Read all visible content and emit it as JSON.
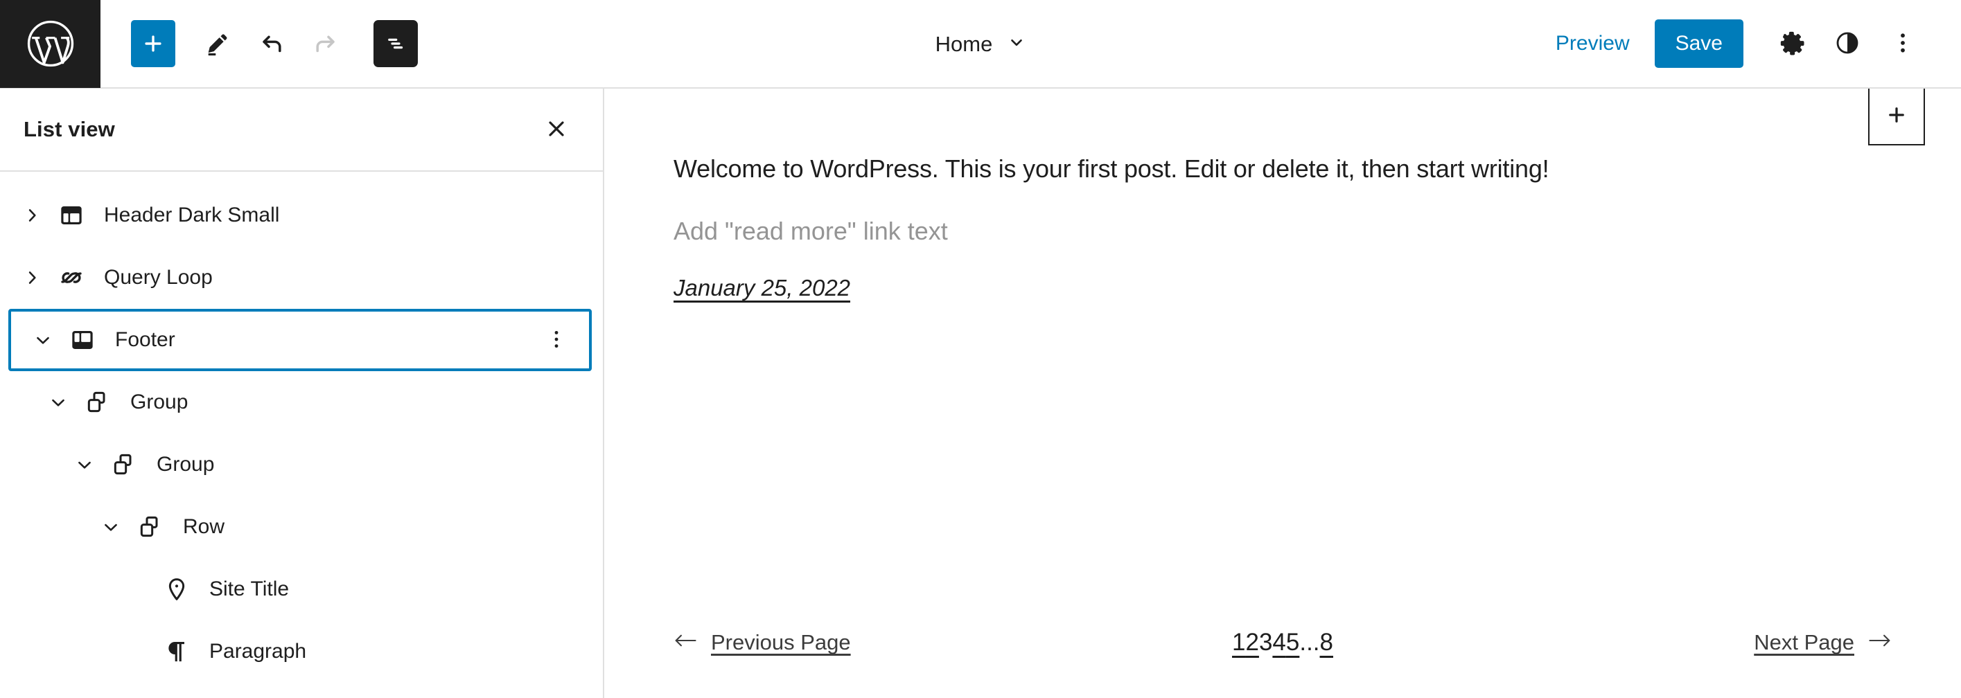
{
  "header": {
    "logo_icon": "wordpress-logo-icon",
    "tools": [
      {
        "name": "add-block-button",
        "icon": "plus-icon",
        "label": "Add block",
        "state": "primary"
      },
      {
        "name": "edit-tool-button",
        "icon": "pencil-icon",
        "label": "Edit",
        "state": "default"
      },
      {
        "name": "undo-button",
        "icon": "undo-arrow-icon",
        "label": "Undo",
        "state": "enabled"
      },
      {
        "name": "redo-button",
        "icon": "redo-arrow-icon",
        "label": "Redo",
        "state": "disabled"
      },
      {
        "name": "list-view-button",
        "icon": "list-view-icon",
        "label": "List View",
        "state": "active"
      }
    ],
    "document_title": "Home",
    "document_chevron_icon": "chevron-down-icon",
    "preview_label": "Preview",
    "save_label": "Save",
    "settings_icon": "gear-icon",
    "styles_icon": "contrast-icon",
    "options_icon": "more-vertical-icon",
    "accent_color": "#007cba",
    "dark_color": "#1e1e1e"
  },
  "sidebar": {
    "title": "List view",
    "close_icon": "close-icon",
    "items": [
      {
        "label": "Header Dark Small",
        "icon": "template-part-header-icon",
        "depth": 0,
        "twisty": "chevron-right-icon",
        "selected": false,
        "has_more": false
      },
      {
        "label": "Query Loop",
        "icon": "loop-icon",
        "depth": 0,
        "twisty": "chevron-right-icon",
        "selected": false,
        "has_more": false
      },
      {
        "label": "Footer",
        "icon": "template-part-footer-icon",
        "depth": 0,
        "twisty": "chevron-down-icon",
        "selected": true,
        "has_more": true,
        "more_icon": "more-vertical-icon"
      },
      {
        "label": "Group",
        "icon": "group-icon",
        "depth": 1,
        "twisty": "chevron-down-icon",
        "selected": false,
        "has_more": false
      },
      {
        "label": "Group",
        "icon": "group-icon",
        "depth": 2,
        "twisty": "chevron-down-icon",
        "selected": false,
        "has_more": false
      },
      {
        "label": "Row",
        "icon": "group-row-icon",
        "depth": 3,
        "twisty": "chevron-down-icon",
        "selected": false,
        "has_more": false
      },
      {
        "label": "Site Title",
        "icon": "map-pin-icon",
        "depth": 4,
        "twisty": "",
        "selected": false,
        "has_more": false
      },
      {
        "label": "Paragraph",
        "icon": "pilcrow-icon",
        "depth": 4,
        "twisty": "",
        "selected": false,
        "has_more": false
      }
    ]
  },
  "canvas": {
    "inserter_icon": "plus-icon",
    "post_excerpt": "Welcome to WordPress. This is your first post. Edit or delete it, then start writing!",
    "read_more_placeholder": "Add \"read more\" link text",
    "post_date": "January 25, 2022",
    "pagination": {
      "previous_label": "Previous Page",
      "previous_icon": "arrow-left-icon",
      "next_label": "Next Page",
      "next_icon": "arrow-right-icon",
      "pages": [
        "1",
        "2",
        "3",
        "4",
        "5"
      ],
      "ellipsis": "...",
      "last_page": "8",
      "current_page": "3"
    }
  }
}
